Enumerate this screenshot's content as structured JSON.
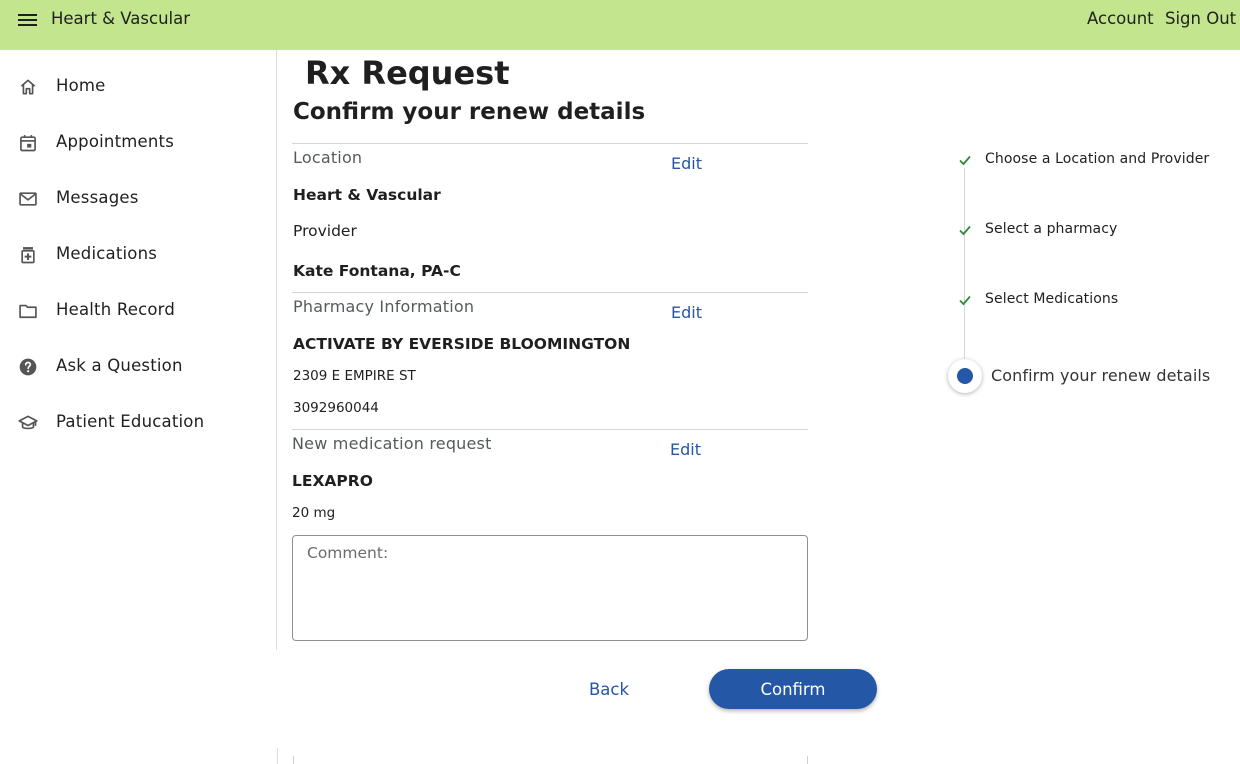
{
  "header": {
    "title": "Heart & Vascular",
    "account": "Account",
    "sign_out": "Sign Out",
    "bg_color": "#c2e58d"
  },
  "sidebar": {
    "items": [
      {
        "label": "Home",
        "icon": "home-icon"
      },
      {
        "label": "Appointments",
        "icon": "calendar-icon"
      },
      {
        "label": "Messages",
        "icon": "mail-icon"
      },
      {
        "label": "Medications",
        "icon": "medication-icon"
      },
      {
        "label": "Health Record",
        "icon": "folder-icon"
      },
      {
        "label": "Ask a Question",
        "icon": "help-icon"
      },
      {
        "label": "Patient Education",
        "icon": "school-icon"
      }
    ]
  },
  "main": {
    "title": "Rx Request",
    "subtitle": "Confirm your renew details",
    "location": {
      "label": "Location",
      "edit": "Edit",
      "value": "Heart & Vascular",
      "provider_label": "Provider",
      "provider_value": "Kate Fontana, PA-C"
    },
    "pharmacy": {
      "label": "Pharmacy Information",
      "edit": "Edit",
      "name": "ACTIVATE BY EVERSIDE BLOOMINGTON",
      "address": "2309 E EMPIRE ST",
      "phone": "3092960044"
    },
    "medication": {
      "label": "New medication request",
      "edit": "Edit",
      "name": "LEXAPRO",
      "dose": "20 mg"
    },
    "comment_placeholder": "Comment:",
    "back_label": "Back",
    "confirm_label": "Confirm",
    "accent_color": "#2557a7"
  },
  "stepper": {
    "steps": [
      {
        "label": "Choose a Location and Provider",
        "state": "done"
      },
      {
        "label": "Select a pharmacy",
        "state": "done"
      },
      {
        "label": "Select Medications",
        "state": "done"
      },
      {
        "label": "Confirm your renew details",
        "state": "current"
      }
    ],
    "check_color": "#2e8b3a"
  }
}
